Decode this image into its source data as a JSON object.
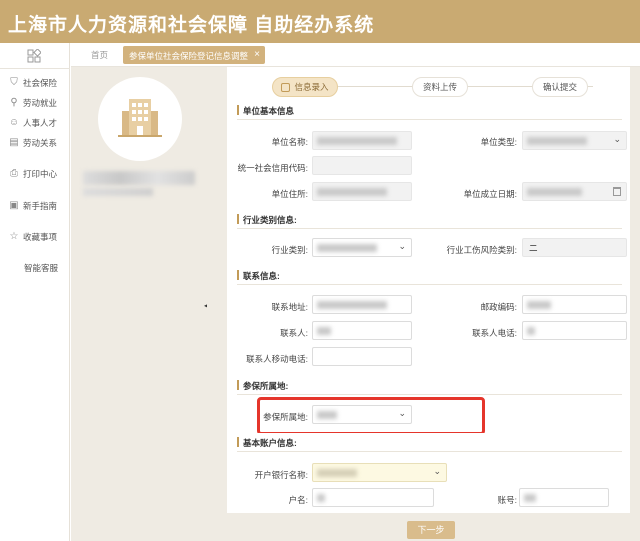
{
  "header": {
    "title": "上海市人力资源和社会保障 自助经办系统"
  },
  "sidebar": {
    "items": [
      {
        "label": "社会保险",
        "icon": "shield-icon"
      },
      {
        "label": "劳动就业",
        "icon": "person-icon"
      },
      {
        "label": "人事人才",
        "icon": "people-icon"
      },
      {
        "label": "劳动关系",
        "icon": "handshake-icon"
      },
      {
        "label": "打印中心",
        "icon": "printer-icon"
      },
      {
        "label": "新手指南",
        "icon": "book-icon"
      },
      {
        "label": "收藏事项",
        "icon": "star-icon"
      },
      {
        "label": "智能客服",
        "icon": ""
      }
    ]
  },
  "tabs": {
    "home": "首页",
    "active": "参保单位社会保险登记信息调整"
  },
  "steps": [
    "信息录入",
    "资料上传",
    "确认提交"
  ],
  "sections": {
    "basic": "单位基本信息",
    "industry": "行业类别信息:",
    "contact": "联系信息:",
    "location": "参保所属地:",
    "bank": "基本账户信息:"
  },
  "fields": {
    "unit_name": "单位名称:",
    "unit_type": "单位类型:",
    "credit_code": "统一社会信用代码:",
    "unit_address": "单位住所:",
    "unit_date": "单位成立日期:",
    "industry_type": "行业类别:",
    "injury_risk": "行业工伤风险类别:",
    "injury_risk_value": "二",
    "contact_address": "联系地址:",
    "postal_code": "邮政编码:",
    "contact_person": "联系人:",
    "contact_phone": "联系人电话:",
    "mobile": "联系人移动电话:",
    "insured_location": "参保所属地:",
    "bank_name": "开户银行名称:",
    "account_name": "户名:",
    "account_no": "账号:"
  },
  "buttons": {
    "next": "下一步"
  },
  "colors": {
    "brand": "#c9aa72",
    "highlight": "#e5352b"
  }
}
